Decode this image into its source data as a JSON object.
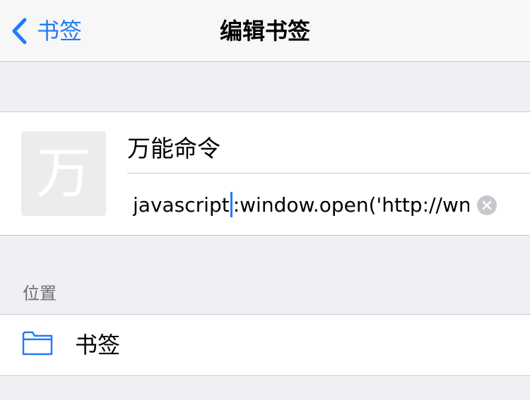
{
  "nav": {
    "back_label": "书签",
    "title": "编辑书签"
  },
  "bookmark": {
    "thumb_char": "万",
    "title": "万能命令",
    "url_before_caret": "javascript",
    "url_after_caret": ":window.open('http://wn.ru"
  },
  "location": {
    "section_label": "位置",
    "folder_label": "书签"
  },
  "colors": {
    "accent": "#1f7cf6",
    "background": "#efeff4",
    "separator": "#c8c7cc"
  },
  "icons": {
    "back": "chevron-left-icon",
    "clear": "clear-circle-icon",
    "folder": "folder-icon"
  }
}
